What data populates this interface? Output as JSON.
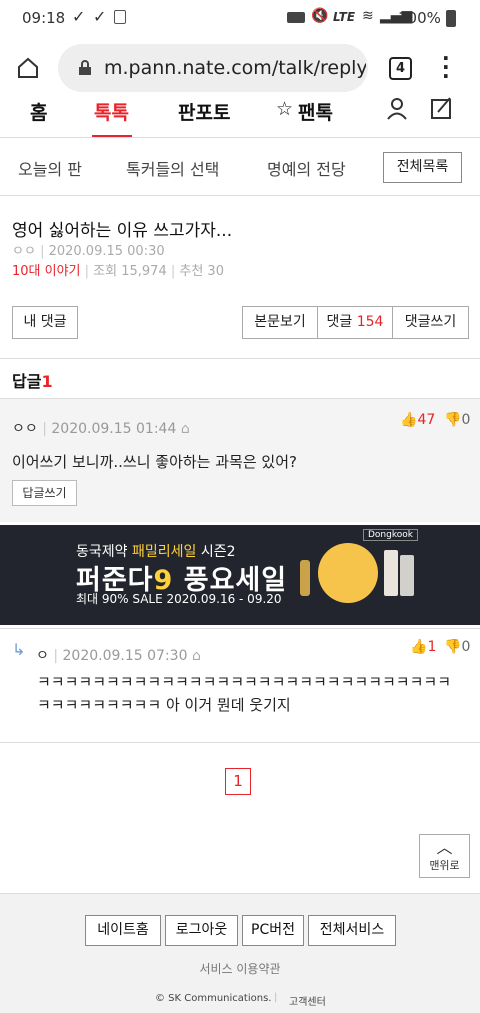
{
  "status_bar": {
    "time": "09:18",
    "battery": "100%",
    "net": "LTE"
  },
  "browser": {
    "url": "m.pann.nate.com/talk/reply",
    "tab_count": "4"
  },
  "top_nav": {
    "items": [
      "홈",
      "톡톡",
      "판포토",
      "팬톡"
    ],
    "active": "톡톡"
  },
  "sub_nav": {
    "items": [
      "오늘의 판",
      "톡커들의 선택",
      "명예의 전당"
    ],
    "all_button": "전체목록"
  },
  "post": {
    "title": "영어 싫어하는 이유 쓰고가자...",
    "author": "ㅇㅇ",
    "date": "2020.09.15 00:30",
    "category": "10대 이야기",
    "views": "조회 15,974",
    "recommends": "추천 30"
  },
  "actions": {
    "my_comments": "내 댓글",
    "view_post": "본문보기",
    "comments_label": "댓글",
    "comments_count": "154",
    "write_comment": "댓글쓰기"
  },
  "reply_section": {
    "label": "답글",
    "count": "1"
  },
  "comment": {
    "author": "ㅇㅇ",
    "date": "2020.09.15 01:44",
    "likes": "47",
    "dislikes": "0",
    "text": "이어쓰기 보니까..쓰니 좋아하는 과목은 있어?",
    "reply_button": "답글쓰기"
  },
  "ad": {
    "line1_prefix": "동국제약 ",
    "line1_highlight": "패밀리세일",
    "line1_suffix": " 시즌2",
    "headline_pre": "퍼준다",
    "headline_num": "9",
    "headline_post": " 풍요세일",
    "line3": "최대 90% SALE  2020.09.16 - 09.20",
    "brand": "Dongkook"
  },
  "reply": {
    "author": "ㅇ",
    "date": "2020.09.15 07:30",
    "likes": "1",
    "dislikes": "0",
    "text_line1": "ㅋㅋㅋㅋㅋㅋㅋㅋㅋㅋㅋㅋㅋㅋㅋㅋㅋㅋㅋㅋㅋㅋㅋㅋㅋㅋㅋㅋㅋㅋ",
    "text_line2": "ㅋㅋㅋㅋㅋㅋㅋㅋㅋ 아 이거 뭔데 웃기지"
  },
  "pagination": {
    "current": "1"
  },
  "to_top": "맨위로",
  "footer": {
    "buttons": [
      "네이트홈",
      "로그아웃",
      "PC버전",
      "전체서비스"
    ],
    "terms": "서비스 이용약관",
    "copyright": "© SK Communications.",
    "customer_center": "고객센터"
  },
  "colors": {
    "accent": "#e8242b",
    "banner_bg": "#23252e",
    "banner_highlight": "#ffd23a"
  }
}
